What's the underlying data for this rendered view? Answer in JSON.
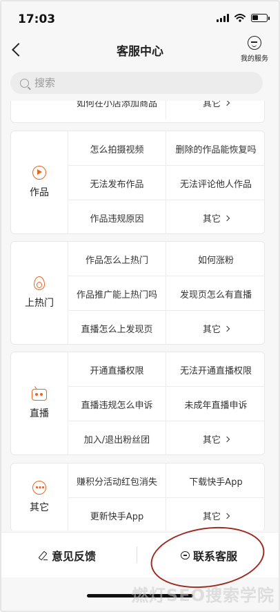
{
  "status": {
    "time": "17:03"
  },
  "header": {
    "title": "客服中心",
    "my_service": "我的服务"
  },
  "search": {
    "placeholder": "搜索"
  },
  "partial_row": {
    "left": "如何在小店添加商品",
    "right": "其它"
  },
  "cards": [
    {
      "category": "作品",
      "icon": "play-circle-icon",
      "rows": [
        [
          "怎么拍摄视频",
          "删除的作品能恢复吗"
        ],
        [
          "无法发布作品",
          "无法评论他人作品"
        ],
        [
          "作品违规原因",
          "其它"
        ]
      ]
    },
    {
      "category": "上热门",
      "icon": "flame-icon",
      "rows": [
        [
          "作品怎么上热门",
          "如何涨粉"
        ],
        [
          "作品推广能上热门吗",
          "发现页怎么有直播"
        ],
        [
          "直播怎么上发现页",
          "其它"
        ]
      ]
    },
    {
      "category": "直播",
      "icon": "tv-icon",
      "rows": [
        [
          "开通直播权限",
          "无法开通直播权限"
        ],
        [
          "直播违规怎么申诉",
          "未成年直播申诉"
        ],
        [
          "加入/退出粉丝团",
          "其它"
        ]
      ]
    },
    {
      "category": "其它",
      "icon": "more-circle-icon",
      "rows": [
        [
          "赚积分活动红包消失",
          "下载快手App"
        ],
        [
          "更新快手App",
          "其它"
        ]
      ]
    }
  ],
  "bottom": {
    "feedback": "意见反馈",
    "contact": "联系客服"
  },
  "watermark": "燃灯SEO搜索学院",
  "colors": {
    "accent": "#f0611f",
    "annotation_ring": "#9b2c22"
  }
}
